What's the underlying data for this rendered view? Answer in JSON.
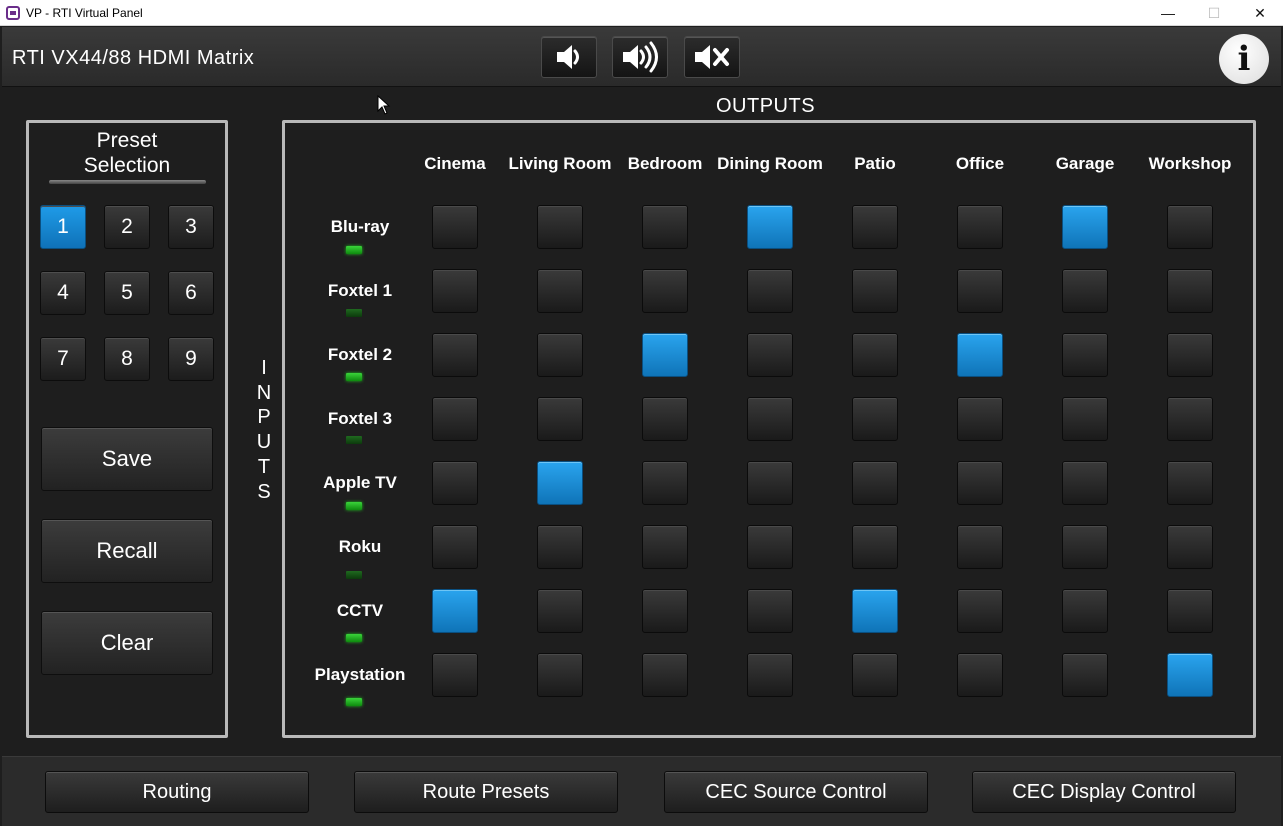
{
  "window": {
    "title": "VP - RTI Virtual Panel",
    "minimize": "—",
    "maximize": "☐",
    "close": "✕"
  },
  "header": {
    "device_title": "RTI VX44/88 HDMI Matrix",
    "volume_buttons": [
      {
        "name": "volume-down",
        "icon": "speaker-low-icon"
      },
      {
        "name": "volume-up",
        "icon": "speaker-high-icon"
      },
      {
        "name": "mute",
        "icon": "speaker-mute-icon"
      }
    ],
    "info_label": "i"
  },
  "presets": {
    "title_line1": "Preset",
    "title_line2": "Selection",
    "numbers": [
      "1",
      "2",
      "3",
      "4",
      "5",
      "6",
      "7",
      "8",
      "9"
    ],
    "selected": "1",
    "save_label": "Save",
    "recall_label": "Recall",
    "clear_label": "Clear"
  },
  "matrix": {
    "outputs_title": "OUTPUTS",
    "inputs_title": [
      "I",
      "N",
      "P",
      "U",
      "T",
      "S"
    ],
    "outputs": [
      "Cinema",
      "Living Room",
      "Bedroom",
      "Dining Room",
      "Patio",
      "Office",
      "Garage",
      "Workshop"
    ],
    "inputs": [
      {
        "name": "Blu-ray",
        "led_active": true
      },
      {
        "name": "Foxtel 1",
        "led_active": false
      },
      {
        "name": "Foxtel 2",
        "led_active": true
      },
      {
        "name": "Foxtel 3",
        "led_active": false
      },
      {
        "name": "Apple TV",
        "led_active": true
      },
      {
        "name": "Roku",
        "led_active": false
      },
      {
        "name": "CCTV",
        "led_active": true
      },
      {
        "name": "Playstation",
        "led_active": true
      }
    ],
    "routes": [
      [
        0,
        0,
        0,
        1,
        0,
        0,
        1,
        0
      ],
      [
        0,
        0,
        0,
        0,
        0,
        0,
        0,
        0
      ],
      [
        0,
        0,
        1,
        0,
        0,
        1,
        0,
        0
      ],
      [
        0,
        0,
        0,
        0,
        0,
        0,
        0,
        0
      ],
      [
        0,
        1,
        0,
        0,
        0,
        0,
        0,
        0
      ],
      [
        0,
        0,
        0,
        0,
        0,
        0,
        0,
        0
      ],
      [
        1,
        0,
        0,
        0,
        1,
        0,
        0,
        0
      ],
      [
        0,
        0,
        0,
        0,
        0,
        0,
        0,
        1
      ]
    ],
    "active_color": "#1a8fdc"
  },
  "nav": {
    "tabs": [
      "Routing",
      "Route Presets",
      "CEC Source Control",
      "CEC Display Control"
    ]
  }
}
